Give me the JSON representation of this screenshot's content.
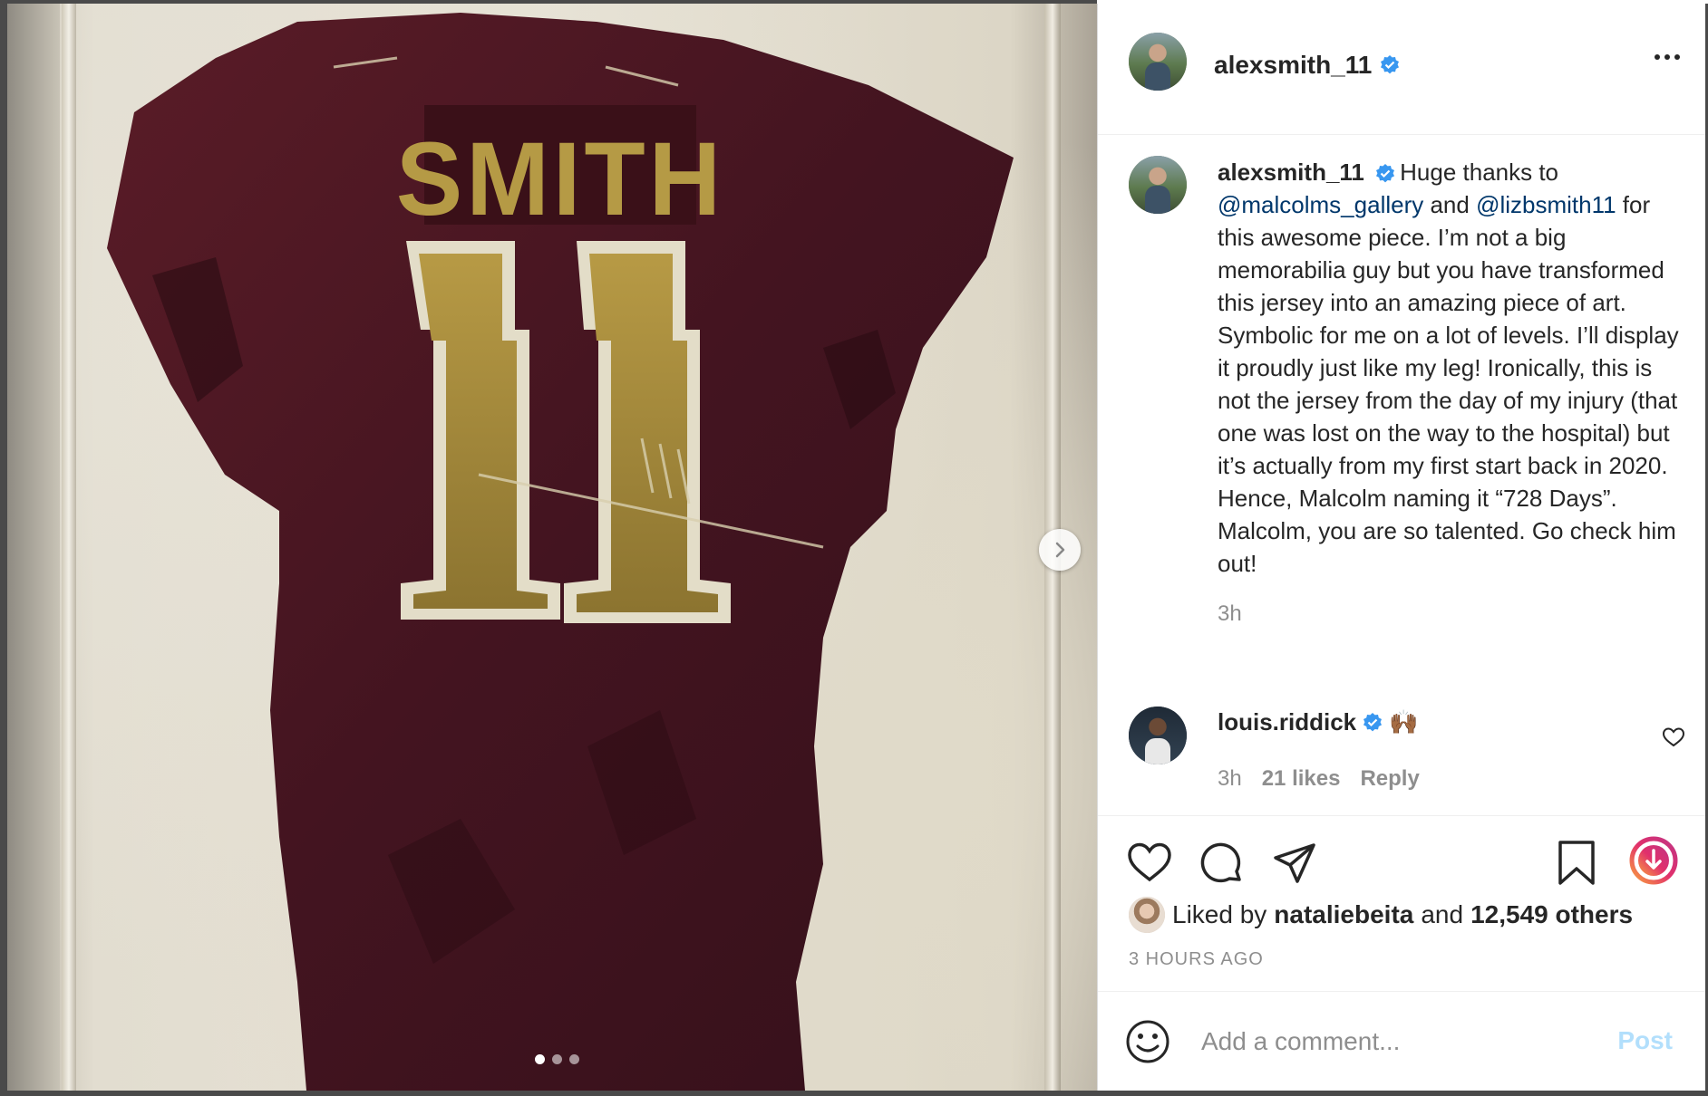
{
  "post": {
    "username": "alexsmith_11",
    "more_label": "More options"
  },
  "caption": {
    "username": "alexsmith_11",
    "part1": "Huge thanks to ",
    "mention1": "@malcolms_gallery",
    "part2": " and ",
    "mention2": "@lizbsmith11",
    "part3": " for this awesome piece. I’m not a big memorabilia guy but you have transformed this jersey into an amazing piece of art. Symbolic for me on a lot of levels. I’ll display it proudly just like my leg! Ironically, this is not the jersey from the day of my injury (that one was lost on the way to the hospital) but it’s actually from my first start back in 2020. Hence, Malcolm naming it “728 Days”. Malcolm, you are so talented. Go check him out!",
    "time": "3h"
  },
  "comment": {
    "username": "louis.riddick",
    "text": "🙌🏾",
    "time": "3h",
    "likes": "21 likes",
    "reply": "Reply"
  },
  "jersey": {
    "name": "SMITH",
    "number": "11"
  },
  "likes": {
    "prefix": "Liked by",
    "user": "nataliebeita",
    "mid": "and",
    "others": "12,549 others"
  },
  "timestamp": "3 HOURS AGO",
  "add_comment": {
    "placeholder": "Add a comment...",
    "post_label": "Post"
  },
  "carousel": {
    "count": 3,
    "active": 0
  },
  "colors": {
    "verified": "#3897f0",
    "mention": "#00376b",
    "jersey": "#4a1620",
    "gold": "#a88a36"
  }
}
